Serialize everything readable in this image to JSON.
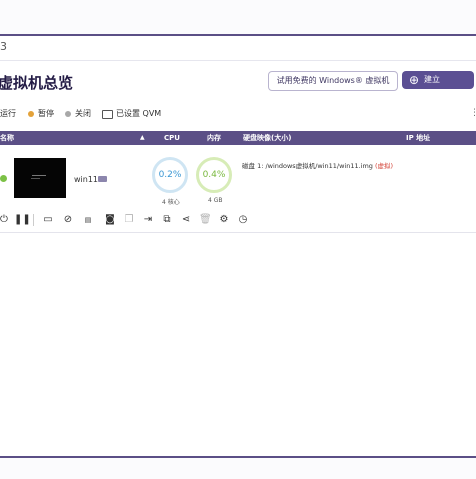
{
  "window": {
    "title_fragment": "3"
  },
  "header": {
    "title": "虚拟机总览",
    "trial_button": "试用免费的 Windows® 虚拟机",
    "create_button": "建立",
    "create_icon": "plus-icon"
  },
  "legend": {
    "running": "运行",
    "paused": "暂停",
    "stopped": "关闭",
    "qvm": "已设置 QVM",
    "colors": {
      "running": "#5aa84a",
      "paused": "#e3a23a",
      "stopped": "#a8a8a8"
    }
  },
  "table": {
    "columns": {
      "name": "名称",
      "cpu": "CPU",
      "memory": "内存",
      "disk": "硬盘映像(大小)",
      "ip": "IP 地址"
    },
    "rows": [
      {
        "name": "win11",
        "status_color": "#7cc146",
        "cpu_usage": "0.2%",
        "cpu_cores": "4 核心",
        "memory_usage": "0.4%",
        "memory_size": "4 GB",
        "disk_prefix": "磁盘 1: /windows虚拟机/win11/win11.img",
        "disk_note": "(虚拟)"
      }
    ]
  },
  "toolbar": {
    "icons": [
      "power-icon",
      "pause-icon",
      "console-icon",
      "reset-icon",
      "rename-icon",
      "snapshot-icon",
      "copy-icon",
      "export-icon",
      "clone-icon",
      "share-icon",
      "delete-icon",
      "settings-icon",
      "history-icon"
    ]
  },
  "theme": {
    "accent": "#5b4f93",
    "header_bg": "#5b4f86"
  }
}
